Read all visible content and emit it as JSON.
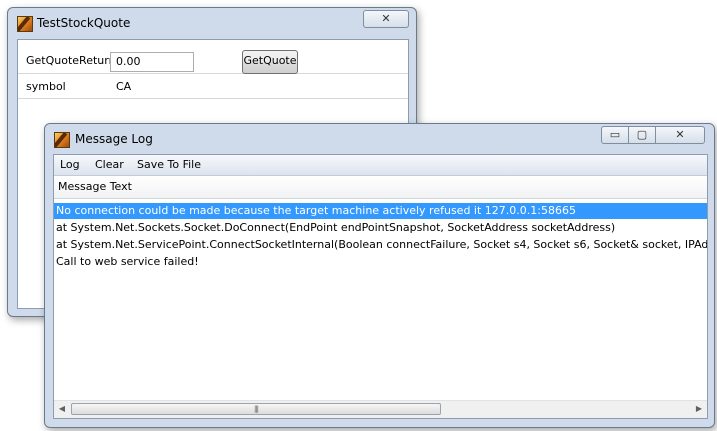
{
  "test_window": {
    "title": "TestStockQuote",
    "close_glyph": "✕",
    "rows": [
      {
        "label": "GetQuoteReturn",
        "value": "0.00",
        "button_label": "GetQuote"
      },
      {
        "label": "symbol",
        "value": "CA"
      }
    ]
  },
  "log_window": {
    "title": "Message Log",
    "controls": {
      "minimize": "▭",
      "maximize": "▢",
      "close": "✕"
    },
    "menu": [
      "Log",
      "Clear",
      "Save To File"
    ],
    "column_header": "Message Text",
    "lines": [
      {
        "text": "No connection could be made because the target machine actively refused it 127.0.0.1:58665",
        "selected": true
      },
      {
        "text": "   at System.Net.Sockets.Socket.DoConnect(EndPoint endPointSnapshot, SocketAddress socketAddress)",
        "selected": false
      },
      {
        "text": "   at System.Net.ServicePoint.ConnectSocketInternal(Boolean connectFailure, Socket s4, Socket s6, Socket& socket, IPAddress& address",
        "selected": false
      },
      {
        "text": "Call to web service failed!",
        "selected": false
      }
    ],
    "scrollbar": {
      "left_arrow": "◀",
      "right_arrow": "▶",
      "thumb_grip": "|||"
    }
  },
  "colors": {
    "selection": "#3399ff",
    "window_frame": "#cfdbea"
  },
  "icons": [
    "app-icon",
    "close-icon",
    "minimize-icon",
    "maximize-icon",
    "scroll-left-icon",
    "scroll-right-icon"
  ]
}
